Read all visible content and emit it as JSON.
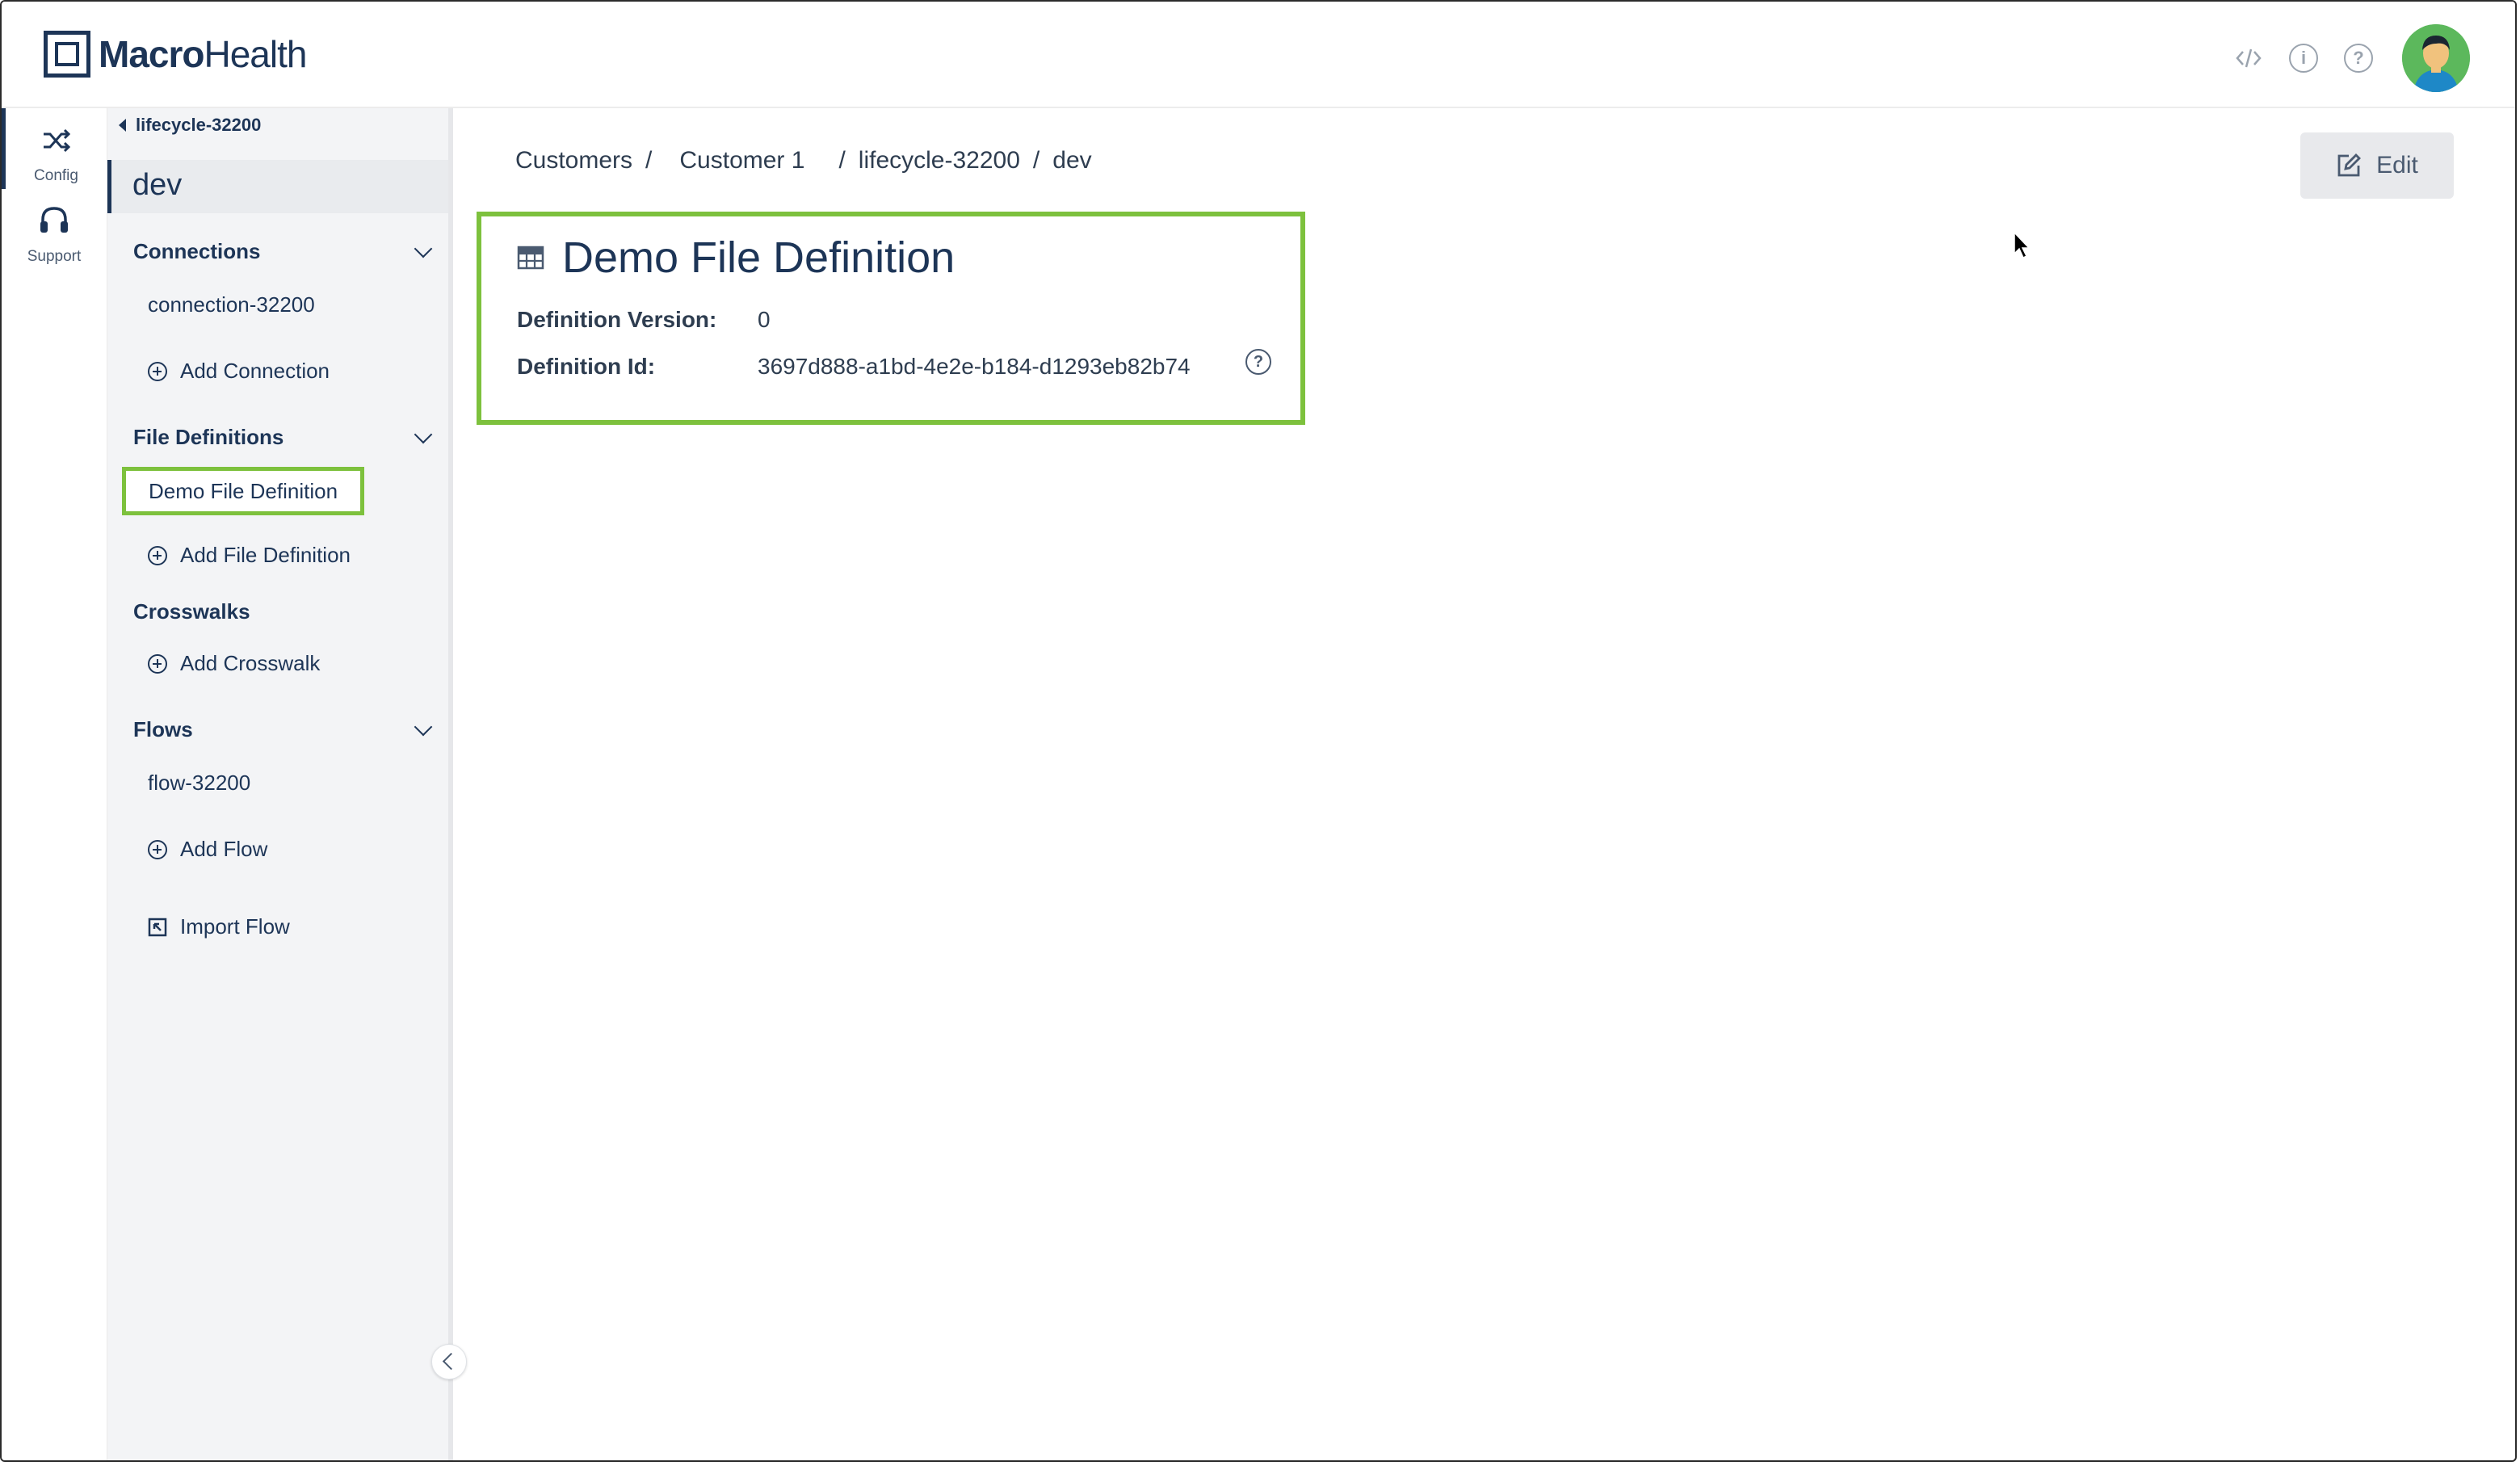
{
  "brand": {
    "name_bold": "Macro",
    "name_rest": "Health"
  },
  "header_icons": [
    "code-icon",
    "info-icon",
    "help-icon"
  ],
  "rail": [
    {
      "label": "Config",
      "icon": "shuffle-icon",
      "active": true
    },
    {
      "label": "Support",
      "icon": "headset-icon",
      "active": false
    }
  ],
  "sidebar": {
    "back_label": "lifecycle-32200",
    "environment": "dev",
    "connections": {
      "title": "Connections",
      "items": [
        "connection-32200"
      ],
      "add_label": "Add Connection"
    },
    "file_definitions": {
      "title": "File Definitions",
      "items": [
        "Demo File Definition"
      ],
      "add_label": "Add File Definition"
    },
    "crosswalks": {
      "title": "Crosswalks",
      "add_label": "Add Crosswalk"
    },
    "flows": {
      "title": "Flows",
      "items": [
        "flow-32200"
      ],
      "add_label": "Add Flow",
      "import_label": "Import Flow"
    }
  },
  "breadcrumb": [
    "Customers",
    "Customer 1",
    "lifecycle-32200",
    "dev"
  ],
  "edit_label": "Edit",
  "definition": {
    "title": "Demo File Definition",
    "version_label": "Definition Version:",
    "version_value": "0",
    "id_label": "Definition Id:",
    "id_value": "3697d888-a1bd-4e2e-b184-d1293eb82b74"
  },
  "colors": {
    "primary": "#1d3557",
    "highlight": "#7dc13d",
    "sidebar_bg": "#f3f4f6"
  }
}
